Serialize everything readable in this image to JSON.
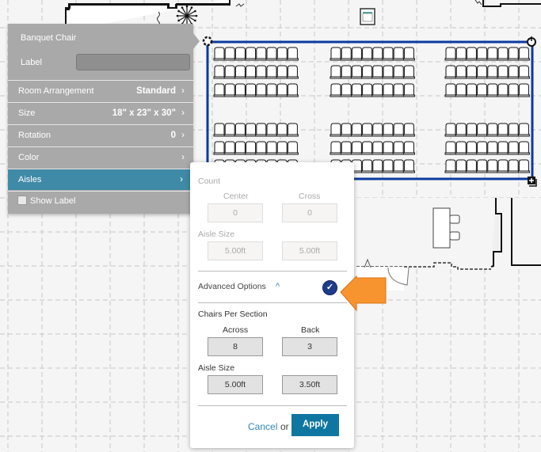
{
  "canvas": {
    "selection_color": "#0b3aa0",
    "seating_sections": 3,
    "rows_per_block": 3,
    "blocks": 2,
    "chairs_per_row": 8
  },
  "panel": {
    "title": "Banquet Chair",
    "label_field_label": "Label",
    "label_value": "",
    "rows": [
      {
        "key": "Room Arrangement",
        "value": "Standard",
        "chevron": "›"
      },
      {
        "key": "Size",
        "value": "18\" x 23\" x 30\"",
        "chevron": "›"
      },
      {
        "key": "Rotation",
        "value": "0",
        "chevron": "›"
      },
      {
        "key": "Color",
        "value": "",
        "chevron": "›"
      },
      {
        "key": "Aisles",
        "value": "",
        "chevron": "›",
        "active": true
      }
    ],
    "show_label": {
      "label": "Show Label",
      "checked": false
    },
    "bg_color": "#a9a9a9",
    "active_color": "#3f8aa6"
  },
  "aisles_popup": {
    "count_label": "Count",
    "center_label": "Center",
    "cross_label": "Cross",
    "center_value": "0",
    "cross_value": "0",
    "aisle_size_label": "Aisle Size",
    "aisle_size_center": "5.00ft",
    "aisle_size_cross": "5.00ft",
    "advanced_label": "Advanced Options",
    "advanced_caret": "^",
    "advanced_checked": true,
    "check_glyph": "✓",
    "chairs_per_section_label": "Chairs Per Section",
    "across_label": "Across",
    "back_label": "Back",
    "across_value": "8",
    "back_value": "3",
    "adv_aisle_size_label": "Aisle Size",
    "adv_aisle_size_across": "5.00ft",
    "adv_aisle_size_back": "3.50ft",
    "cancel_label": "Cancel",
    "or_label": "or",
    "apply_label": "Apply",
    "apply_color": "#0f76a2"
  },
  "callout": {
    "icon": "arrow-left-icon",
    "color": "#f7942f"
  }
}
